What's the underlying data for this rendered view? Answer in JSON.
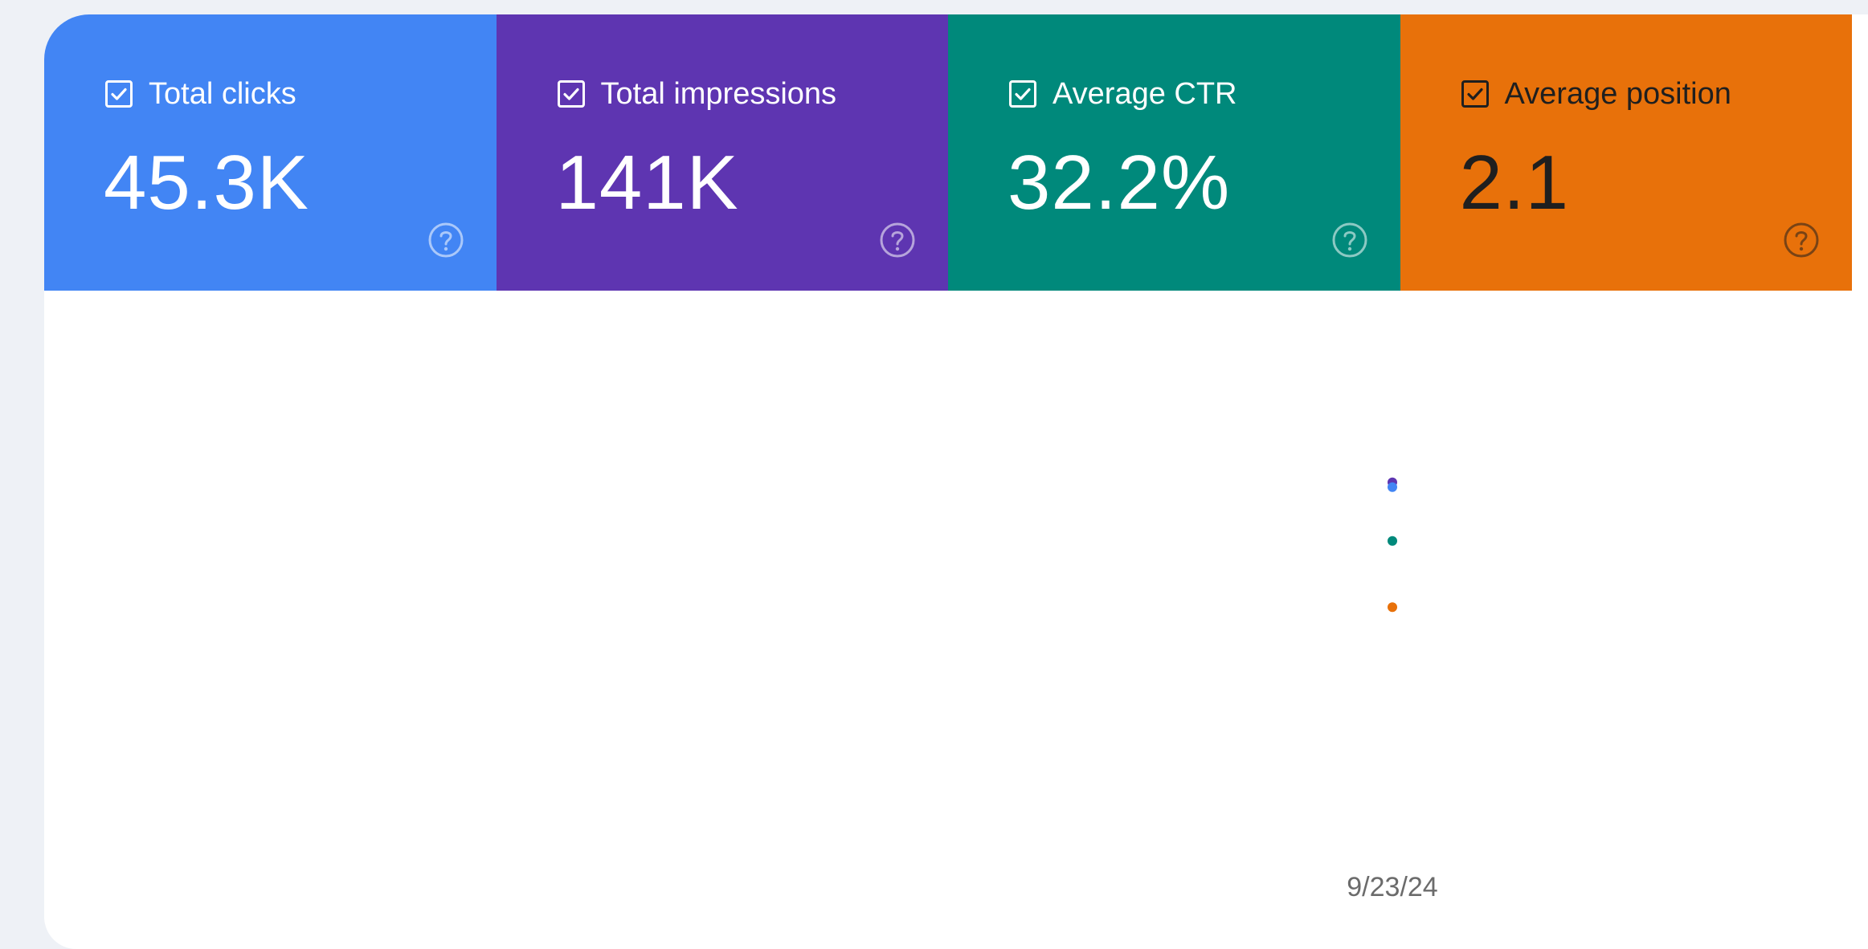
{
  "colors": {
    "clicks": "#4285f4",
    "impressions": "#5e35b1",
    "ctr": "#00897b",
    "position": "#e8710a",
    "page_bg": "#eef1f6"
  },
  "metrics": [
    {
      "key": "clicks",
      "label": "Total clicks",
      "value": "45.3K",
      "checked": true,
      "bg": "#4285f4",
      "fg": "#ffffff",
      "icons": {
        "checkbox": "checkbox-checked-icon",
        "help": "help-circle-icon"
      }
    },
    {
      "key": "impressions",
      "label": "Total impressions",
      "value": "141K",
      "checked": true,
      "bg": "#5e35b1",
      "fg": "#ffffff",
      "icons": {
        "checkbox": "checkbox-checked-icon",
        "help": "help-circle-icon"
      }
    },
    {
      "key": "ctr",
      "label": "Average CTR",
      "value": "32.2%",
      "checked": true,
      "bg": "#00897b",
      "fg": "#ffffff",
      "icons": {
        "checkbox": "checkbox-checked-icon",
        "help": "help-circle-icon"
      }
    },
    {
      "key": "position",
      "label": "Average position",
      "value": "2.1",
      "checked": true,
      "bg": "#e8710a",
      "fg": "#1f1f1f",
      "icons": {
        "checkbox": "checkbox-checked-icon",
        "help": "help-circle-icon"
      }
    }
  ],
  "chart": {
    "x_tick_label": "9/23/24"
  },
  "chart_data": {
    "type": "scatter",
    "x": [
      "9/23/24"
    ],
    "series": [
      {
        "key": "impressions",
        "color": "#5e35b1",
        "values": [
          141000
        ]
      },
      {
        "key": "clicks",
        "color": "#4285f4",
        "values": [
          45300
        ]
      },
      {
        "key": "ctr",
        "color": "#00897b",
        "values": [
          32.2
        ]
      },
      {
        "key": "position",
        "color": "#e8710a",
        "values": [
          2.1
        ]
      }
    ],
    "grid": false,
    "legend": "none"
  }
}
